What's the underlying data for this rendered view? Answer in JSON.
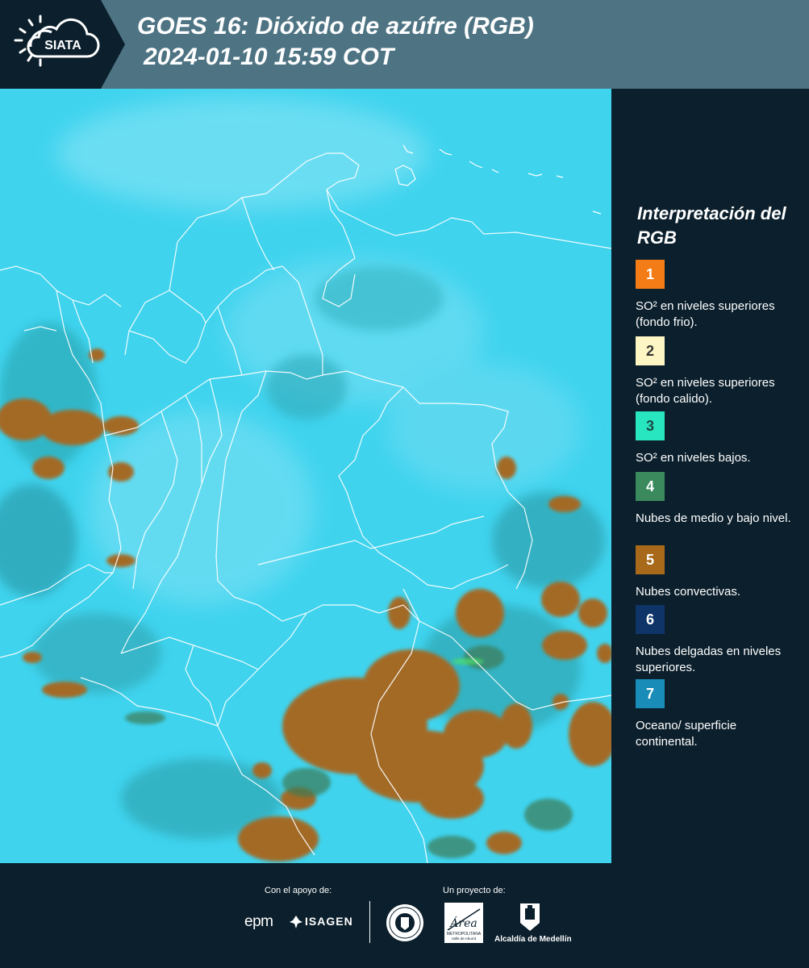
{
  "header": {
    "logo_text": "SIATA",
    "title_line1": "GOES 16: Dióxido de azúfre (RGB)",
    "title_line2": "2024-01-10 15:59 COT"
  },
  "legend": {
    "title": "Interpretación del RGB",
    "items": [
      {
        "number": "1",
        "color": "#f47c16",
        "text_color": "#ffffff",
        "label": "SO² en niveles superiores (fondo frio)."
      },
      {
        "number": "2",
        "color": "#fdf6c4",
        "text_color": "#333333",
        "label": "SO² en niveles superiores (fondo calido)."
      },
      {
        "number": "3",
        "color": "#28e6c0",
        "text_color": "#1a4a44",
        "label": "SO² en niveles bajos."
      },
      {
        "number": "4",
        "color": "#3a8a5e",
        "text_color": "#ffffff",
        "label": "Nubes de medio y bajo nivel."
      },
      {
        "number": "5",
        "color": "#a8691a",
        "text_color": "#ffffff",
        "label": "Nubes convectivas."
      },
      {
        "number": "6",
        "color": "#0f3468",
        "text_color": "#ffffff",
        "label": "Nubes delgadas en niveles superiores."
      },
      {
        "number": "7",
        "color": "#1a8cb8",
        "text_color": "#ffffff",
        "label": "Oceano/ superficie continental."
      }
    ]
  },
  "footer": {
    "support_label": "Con el apoyo de:",
    "project_label": "Un proyecto de:",
    "sponsors": [
      "epm",
      "ISAGEN"
    ],
    "partners": [
      "Área Metropolitana Valle de Aburrá",
      "Alcaldía de Medellín"
    ],
    "area_logo_word": "Área",
    "area_logo_sub1": "METROPOLITANA",
    "area_logo_sub2": "Valle de Aburrá",
    "alcaldia_label": "Alcaldía de Medellín"
  }
}
